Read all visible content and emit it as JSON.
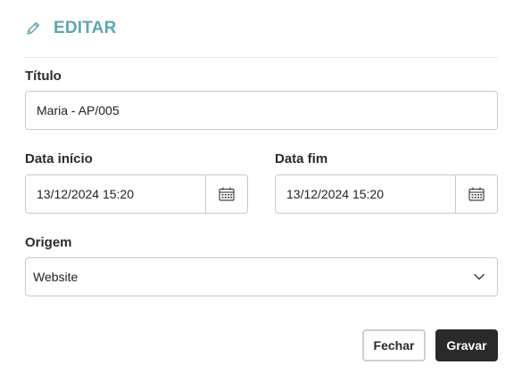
{
  "header": {
    "title": "EDITAR",
    "icon": "pencil-icon"
  },
  "form": {
    "titulo": {
      "label": "Título",
      "value": "Maria - AP/005"
    },
    "data_inicio": {
      "label": "Data início",
      "value": "13/12/2024 15:20",
      "icon": "calendar-icon"
    },
    "data_fim": {
      "label": "Data fim",
      "value": "13/12/2024 15:20",
      "icon": "calendar-icon"
    },
    "origem": {
      "label": "Origem",
      "value": "Website",
      "icon": "chevron-down-icon"
    }
  },
  "actions": {
    "close_label": "Fechar",
    "save_label": "Gravar"
  },
  "colors": {
    "accent": "#5aa7b3",
    "primary_button": "#2a2a2a",
    "border": "#c9c9c9"
  }
}
